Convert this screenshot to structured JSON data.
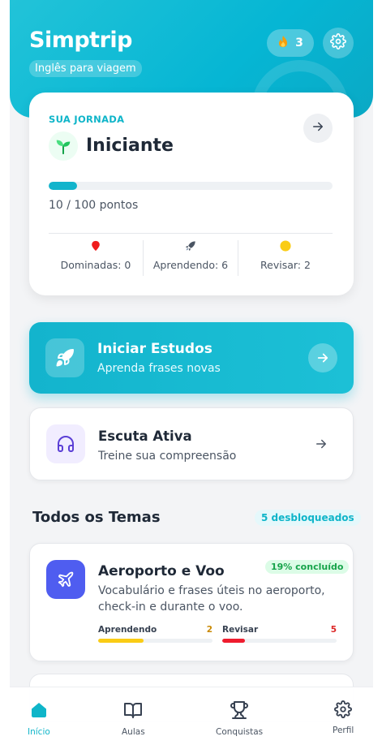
{
  "header": {
    "title": "Simptrip",
    "subtitle": "Inglês para viagem",
    "streak": "3",
    "streak_icon": "flame-icon",
    "settings_icon": "gear-icon"
  },
  "journey": {
    "label": "SUA JORNADA",
    "level": "Iniciante",
    "level_icon": "sprout-icon",
    "progress_fraction": 0.1,
    "points_text": "10 / 100 pontos",
    "stats": [
      {
        "label": "Dominadas: 0",
        "icon": "pin-icon",
        "color": "#ef4444"
      },
      {
        "label": "Aprendendo: 6",
        "icon": "rocket-icon",
        "color": "#475569"
      },
      {
        "label": "Revisar: 2",
        "icon": "circle-icon",
        "color": "#facc15"
      }
    ]
  },
  "cta": {
    "title": "Iniciar Estudos",
    "subtitle": "Aprenda frases novas",
    "icon": "rocket-icon"
  },
  "listening": {
    "title": "Escuta Ativa",
    "subtitle": "Treine sua compreensão",
    "icon": "headphones-icon"
  },
  "themes_section": {
    "title": "Todos os Temas",
    "badge": "5 desbloqueados"
  },
  "theme_card": {
    "title": "Aeroporto e Voo",
    "badge": "19% concluído",
    "description": "Vocabulário e frases úteis no aeroporto, check-in e durante o voo.",
    "icon": "airplane-icon",
    "learning": {
      "label": "Aprendendo",
      "count": "2",
      "fraction": 0.4,
      "color": "#facc15",
      "count_color": "#ca8a04"
    },
    "review": {
      "label": "Revisar",
      "count": "5",
      "fraction": 0.2,
      "color": "#ef1c2e",
      "count_color": "#dc2626"
    }
  },
  "nav": {
    "items": [
      {
        "label": "Início",
        "icon": "home-icon",
        "active": true
      },
      {
        "label": "Aulas",
        "icon": "book-icon",
        "active": false
      },
      {
        "label": "Conquistas",
        "icon": "trophy-icon",
        "active": false
      },
      {
        "label": "Perfil",
        "icon": "gear-icon",
        "active": false
      }
    ]
  },
  "colors": {
    "accent": "#0fb5c9",
    "theme_icon_bg": "#4f5df0"
  }
}
